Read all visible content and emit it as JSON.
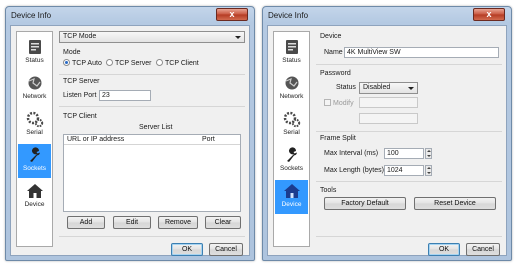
{
  "left_window": {
    "title": "Device Info",
    "close_label": "x",
    "nav": [
      {
        "label": "Status",
        "icon": "status-icon"
      },
      {
        "label": "Network",
        "icon": "network-icon"
      },
      {
        "label": "Serial",
        "icon": "serial-gears-icon"
      },
      {
        "label": "Sockets",
        "icon": "sockets-wrench-icon",
        "selected": true
      },
      {
        "label": "Device",
        "icon": "device-house-icon"
      }
    ],
    "tcp_mode_select": "TCP Mode",
    "mode_label": "Mode",
    "mode_options": [
      {
        "label": "TCP Auto",
        "checked": true
      },
      {
        "label": "TCP Server",
        "checked": false
      },
      {
        "label": "TCP Client",
        "checked": false
      }
    ],
    "tcp_server_label": "TCP Server",
    "listen_port_label": "Listen Port",
    "listen_port_value": "23",
    "tcp_client_label": "TCP Client",
    "server_list_label": "Server List",
    "col_url": "URL or IP address",
    "col_port": "Port",
    "buttons": {
      "add": "Add",
      "edit": "Edit",
      "remove": "Remove",
      "clear": "Clear"
    },
    "ok": "OK",
    "cancel": "Cancel"
  },
  "right_window": {
    "title": "Device Info",
    "close_label": "x",
    "nav": [
      {
        "label": "Status",
        "icon": "status-icon"
      },
      {
        "label": "Network",
        "icon": "network-icon"
      },
      {
        "label": "Serial",
        "icon": "serial-gears-icon"
      },
      {
        "label": "Sockets",
        "icon": "sockets-wrench-icon"
      },
      {
        "label": "Device",
        "icon": "device-house-icon",
        "selected": true
      }
    ],
    "device_label": "Device",
    "name_label": "Name",
    "name_value": "4K MultiView SW",
    "password_label": "Password",
    "status_label": "Status",
    "status_value": "Disabled",
    "modify_label": "Modify",
    "frame_split_label": "Frame Split",
    "max_interval_label": "Max Interval (ms)",
    "max_interval_value": "100",
    "max_length_label": "Max Length (bytes)",
    "max_length_value": "1024",
    "tools_label": "Tools",
    "factory_default": "Factory Default",
    "reset_device": "Reset Device",
    "ok": "OK",
    "cancel": "Cancel"
  },
  "colors": {
    "selection": "#3399ff",
    "title_gradient": "#b4c9e2",
    "close_button": "#c9553e"
  }
}
